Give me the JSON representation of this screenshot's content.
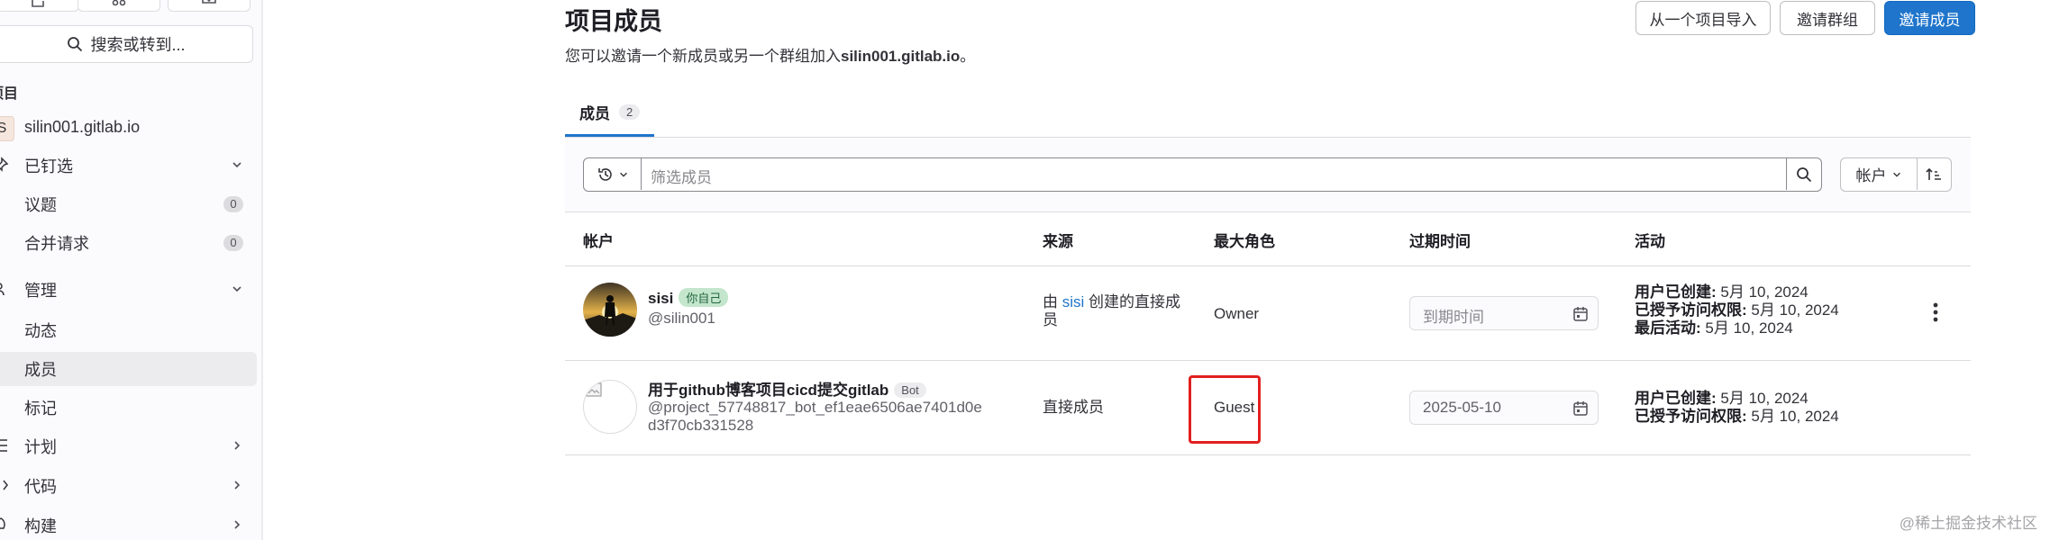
{
  "sidebar": {
    "search_label": "搜索或转到...",
    "section_label": "项目",
    "project_initial": "S",
    "project_name": "silin001.gitlab.io",
    "items": [
      {
        "label": "已钉选"
      },
      {
        "label": "议题",
        "count": "0"
      },
      {
        "label": "合并请求",
        "count": "0"
      },
      {
        "label": "管理"
      },
      {
        "label": "动态"
      },
      {
        "label": "成员"
      },
      {
        "label": "标记"
      },
      {
        "label": "计划"
      },
      {
        "label": "代码"
      },
      {
        "label": "构建"
      }
    ]
  },
  "header": {
    "title": "项目成员",
    "desc_prefix": "您可以邀请一个新成员或另一个群组加入",
    "desc_project": "silin001.gitlab.io",
    "desc_suffix": "。",
    "import_button": "从一个项目导入",
    "invite_group_button": "邀请群组",
    "invite_member_button": "邀请成员"
  },
  "tabs": [
    {
      "label": "成员",
      "count": "2"
    }
  ],
  "filter": {
    "placeholder": "筛选成员",
    "sort_label": "帐户"
  },
  "table": {
    "columns": [
      "帐户",
      "来源",
      "最大角色",
      "过期时间",
      "活动"
    ],
    "rows": [
      {
        "name": "sisi",
        "badge": "你自己",
        "handle": "@silin001",
        "source_prefix": "由",
        "source_link": "sisi",
        "source_suffix": "创建的直接成员",
        "role": "Owner",
        "expiry": "到期时间",
        "activity": [
          {
            "label": "用户已创建:",
            "value": "5月 10, 2024"
          },
          {
            "label": "已授予访问权限:",
            "value": "5月 10, 2024"
          },
          {
            "label": "最后活动:",
            "value": "5月 10, 2024"
          }
        ]
      },
      {
        "name": "用于github博客项目cicd提交gitlab",
        "badge": "Bot",
        "handle_line1": "@project_57748817_bot_ef1eae6506ae7401d0e",
        "handle_line2": "d3f70cb331528",
        "source": "直接成员",
        "role": "Guest",
        "expiry": "2025-05-10",
        "activity": [
          {
            "label": "用户已创建:",
            "value": "5月 10, 2024"
          },
          {
            "label": "已授予访问权限:",
            "value": "5月 10, 2024"
          }
        ]
      }
    ]
  },
  "watermark": "@稀土掘金技术社区",
  "colors": {
    "primary": "#1f75cb",
    "highlight": "#e1201f",
    "badge_green": "#c3e6cd"
  }
}
